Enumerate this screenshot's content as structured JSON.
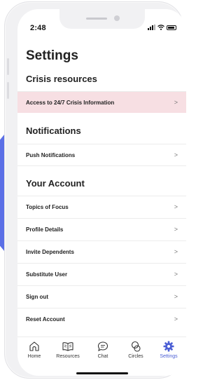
{
  "status_bar": {
    "time": "2:48"
  },
  "page_title": "Settings",
  "sections": {
    "crisis": {
      "title": "Crisis resources",
      "items": [
        {
          "label": "Access to 24/7 Crisis Information"
        }
      ]
    },
    "notifications": {
      "title": "Notifications",
      "items": [
        {
          "label": "Push Notifications"
        }
      ]
    },
    "account": {
      "title": "Your Account",
      "items": [
        {
          "label": "Topics of Focus"
        },
        {
          "label": "Profile Details"
        },
        {
          "label": "Invite Dependents"
        },
        {
          "label": "Substitute User"
        },
        {
          "label": "Sign out"
        },
        {
          "label": "Reset Account"
        }
      ]
    }
  },
  "chevron": ">",
  "tab_bar": {
    "tabs": [
      {
        "label": "Home",
        "icon": "home-icon"
      },
      {
        "label": "Resources",
        "icon": "book-icon"
      },
      {
        "label": "Chat",
        "icon": "chat-icon"
      },
      {
        "label": "Circles",
        "icon": "circles-icon"
      },
      {
        "label": "Settings",
        "icon": "gear-icon",
        "active": true
      }
    ],
    "active_color": "#4c5fd5"
  },
  "colors": {
    "highlight": "#f7dfe3",
    "accent": "#5b6fe6"
  }
}
